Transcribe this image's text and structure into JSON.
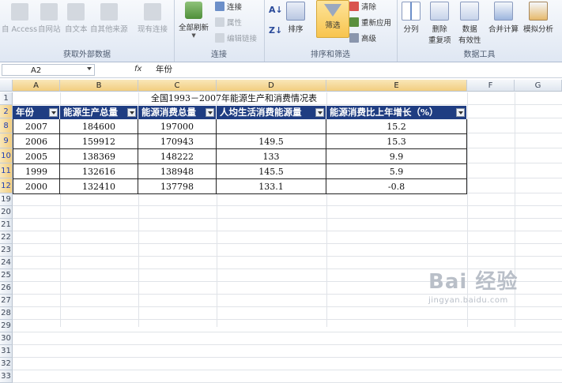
{
  "ribbon": {
    "ext_data": {
      "label": "获取外部数据",
      "buttons": [
        "自 Access",
        "自网站",
        "自文本",
        "自其他来源",
        "现有连接"
      ]
    },
    "connections": {
      "label": "连接",
      "refresh_all": "全部刷新",
      "connections": "连接",
      "properties": "属性",
      "edit_links": "编辑链接"
    },
    "sort_filter": {
      "label": "排序和筛选",
      "sort": "排序",
      "filter": "筛选",
      "clear": "清除",
      "reapply": "重新应用",
      "advanced": "高级"
    },
    "data_tools": {
      "label": "数据工具",
      "split": "分列",
      "remove_dup_1": "删除",
      "remove_dup_2": "重复项",
      "validation_1": "数据",
      "validation_2": "有效性",
      "consolidate": "合并计算",
      "whatif": "模拟分析"
    }
  },
  "formula_bar": {
    "name_box": "A2",
    "fx": "fx",
    "content": "年份"
  },
  "grid": {
    "columns": [
      "A",
      "B",
      "C",
      "D",
      "E",
      "F",
      "G"
    ],
    "rows": [
      "1",
      "2",
      "8",
      "9",
      "10",
      "11",
      "12",
      "19",
      "20",
      "21",
      "22",
      "23",
      "24",
      "25",
      "26",
      "27",
      "28",
      "29",
      "30",
      "31",
      "32",
      "33"
    ],
    "title": "全国1993－2007年能源生产和消费情况表",
    "headers": [
      "年份",
      "能源生产总量",
      "能源消费总量",
      "人均生活消费能源量",
      "能源消费比上年增长（%）"
    ],
    "data": [
      [
        "2007",
        "184600",
        "197000",
        "",
        "15.2"
      ],
      [
        "2006",
        "159912",
        "170943",
        "149.5",
        "15.3"
      ],
      [
        "2005",
        "138369",
        "148222",
        "133",
        "9.9"
      ],
      [
        "1999",
        "132616",
        "138948",
        "145.5",
        "5.9"
      ],
      [
        "2000",
        "132410",
        "137798",
        "133.1",
        "-0.8"
      ]
    ]
  },
  "watermark": {
    "logo": "Bai 经验",
    "sub": "jingyan.baidu.com"
  },
  "colors": {
    "header_bg": "#1f3d82",
    "ribbon_bg": "#dfe7f3",
    "active_btn": "#f8c44e"
  }
}
